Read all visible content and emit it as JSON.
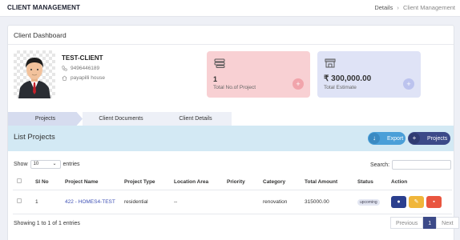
{
  "header": {
    "title": "CLIENT MANAGEMENT",
    "breadcrumbs": [
      "Details",
      "Client Management"
    ]
  },
  "dashboard": {
    "title": "Client Dashboard",
    "client": {
      "name": "TEST-CLIENT",
      "phone": "9496446189",
      "address": "payapilli house"
    },
    "stats": [
      {
        "value": "1",
        "label": "Total No.of Project",
        "icon": "layers-icon",
        "action": "+"
      },
      {
        "value": "₹ 300,000.00",
        "label": "Total Estimate",
        "icon": "store-icon",
        "action": "+"
      }
    ]
  },
  "tabs": [
    "Projects",
    "Client Documents",
    "Client Details"
  ],
  "list": {
    "title": "List Projects",
    "export_label": "Export",
    "projects_label": "Projects",
    "show_prefix": "Show",
    "page_size": "10",
    "show_suffix": "entries",
    "search_label": "Search:",
    "columns": [
      "Sl No",
      "Project Name",
      "Project Type",
      "Location Area",
      "Priority",
      "Category",
      "Total Amount",
      "Status",
      "Action"
    ],
    "rows": [
      {
        "sl": "1",
        "name": "422 - HOMES4-TEST",
        "type": "residential",
        "location": "--",
        "priority": "",
        "category": "renovation",
        "amount": "315000.00",
        "status": "upcoming"
      }
    ],
    "info": "Showing 1 to 1 of 1 entries",
    "pagination": {
      "prev": "Previous",
      "current": "1",
      "next": "Next"
    }
  },
  "colors": {
    "accent": "#3c4a88",
    "export": "#4a9fd8",
    "stat_pink": "#f8d0d3",
    "stat_blue": "#dfe3f6",
    "band": "#d3e9f4"
  }
}
